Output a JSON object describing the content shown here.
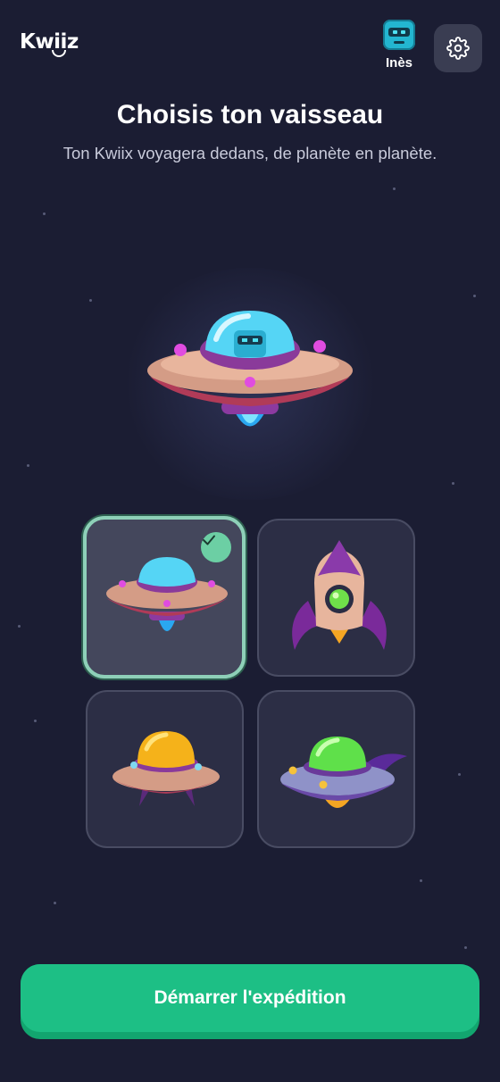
{
  "app": {
    "logo_text": "Kwiiz"
  },
  "header": {
    "profile_name": "Inès",
    "settings_icon": "gear-icon",
    "avatar_icon": "robot-avatar-icon"
  },
  "page": {
    "title": "Choisis ton vaisseau",
    "subtitle": "Ton Kwiix voyagera dedans, de planète en planète."
  },
  "ships": [
    {
      "name": "ufo-blue-dome",
      "selected": true
    },
    {
      "name": "rocket-purple",
      "selected": false
    },
    {
      "name": "ufo-yellow-dome",
      "selected": false
    },
    {
      "name": "ufo-green-dome",
      "selected": false
    }
  ],
  "cta": {
    "label": "Démarrer l'expédition"
  },
  "colors": {
    "background": "#1b1d33",
    "cta": "#1dbf85",
    "selected_border": "#8ed0b8",
    "check_badge": "#6ccfa4"
  }
}
